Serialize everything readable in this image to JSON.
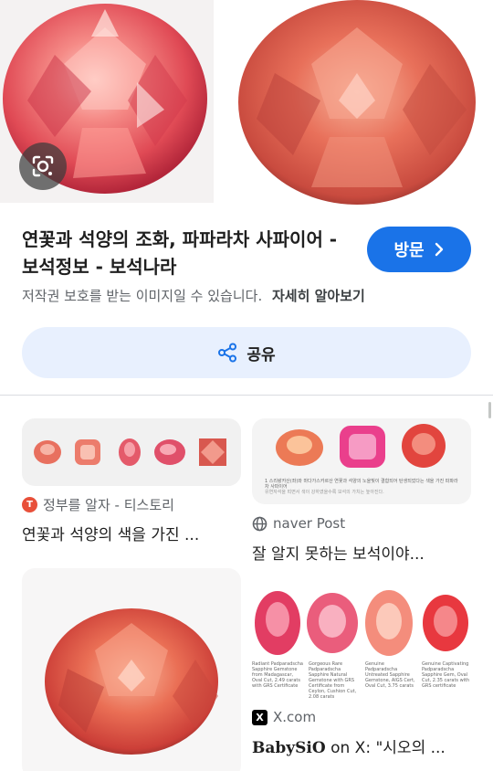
{
  "hero": {
    "lens_icon": "google-lens-icon"
  },
  "result": {
    "title": "연꽃과 석양의 조화, 파파라차 사파이어 - 보석정보 - 보석나라",
    "visit_label": "방문",
    "copyright_notice": "저작권 보호를 받는 이미지일 수 있습니다.",
    "learn_more": "자세히 알아보기",
    "share_label": "공유"
  },
  "related": [
    {
      "source": "정부를 알자 - 티스토리",
      "favicon": "T",
      "title": "연꽃과 석양의 색을 가진 ..."
    },
    {
      "source": "naver Post",
      "favicon": "globe-icon",
      "title": "잘 알지 못하는 보석이야...",
      "caption_line1": "1 스리랑카산(좌)와 마다가스카르산 연꽃과 석양의 노을빛이 결합되어 탄생되었다는 색을 가진 파파라",
      "caption_line2": "차 사파이어",
      "caption_line3": "유연자석을 띠면서 색이 강하였을수록 보석의 가치는 높아진다."
    },
    {
      "source": "X.com",
      "favicon": "X",
      "title_bold": "BabySiO",
      "title_rest": " on X: \"시오의 ...",
      "captions": [
        "Radiant Padparadscha Sapphire Gemstone from Madagascar, Oval Cut, 2.49 carats with GRS Certificate",
        "Gorgeous Rare Padparadscha Sapphire Natural Gemstone with GRS Certificate from Ceylon, Cushion Cut, 2.08 carats",
        "Genuine Padparadscha Untreated Sapphire Gemstone, AIGS Cert, Oval Cut, 3.75 carats",
        "Genuine Captivating Padparadscha Sapphire Gem, Oval Cut, 2.35 carats with GRS certificate"
      ]
    }
  ],
  "colors": {
    "accent": "#1a73e8",
    "share_bg": "#e8f0fe",
    "text": "#1f1f1f",
    "muted": "#5f6368"
  }
}
